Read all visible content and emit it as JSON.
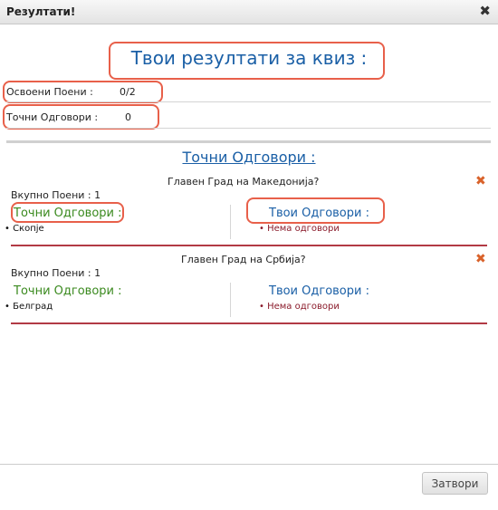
{
  "window": {
    "title": "Резултати!",
    "close_glyph": "✖"
  },
  "summary": {
    "heading": "Твои резултати за квиз :",
    "points_label": "Освоени Поени :",
    "points_value": "0/2",
    "correct_label": "Точни Одговори :",
    "correct_value": "0"
  },
  "section_title": "Точни Одговори :",
  "questions": [
    {
      "text": "Главен Град на Македонија?",
      "points": "Вкупно Поени : 1",
      "correct_header": "Точни Одговори :",
      "your_header": "Твои Одговори :",
      "correct_answer": "Скопје",
      "your_answer": "Нема одговори"
    },
    {
      "text": "Главен Град на Србија?",
      "points": "Вкупно Поени : 1",
      "correct_header": "Точни Одговори :",
      "your_header": "Твои Одговори :",
      "correct_answer": "Белград",
      "your_answer": "Нема одговори"
    }
  ],
  "footer": {
    "close_button": "Затвори"
  },
  "colors": {
    "heading_blue": "#1a5fa6",
    "correct_green": "#3b8a1f",
    "answer_red": "#8a1a2a",
    "highlight": "#e8604a",
    "divider_red": "#b23a44"
  }
}
